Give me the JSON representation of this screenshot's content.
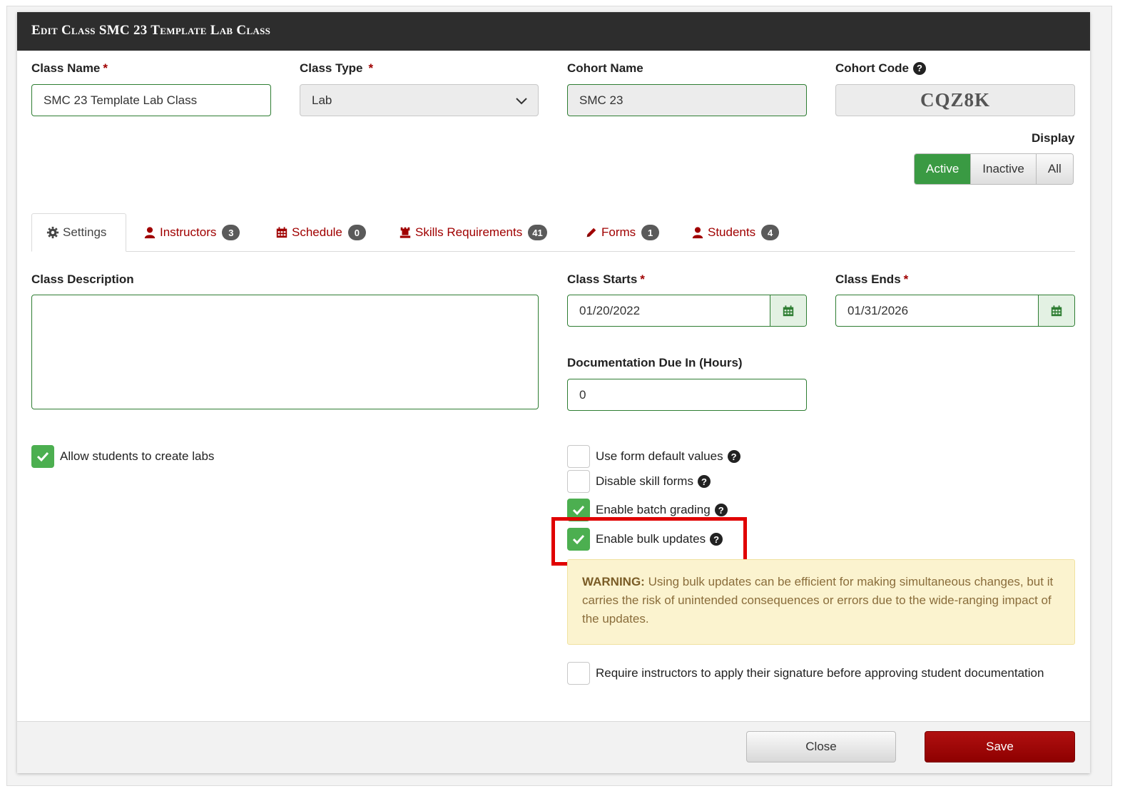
{
  "modal": {
    "title": "Edit Class SMC 23 Template Lab Class"
  },
  "fields": {
    "class_name": {
      "label": "Class Name",
      "required": "*",
      "value": "SMC 23 Template Lab Class"
    },
    "class_type": {
      "label": "Class Type",
      "required": "*",
      "value": "Lab"
    },
    "cohort_name": {
      "label": "Cohort Name",
      "value": "SMC 23"
    },
    "cohort_code": {
      "label": "Cohort Code",
      "value": "CQZ8K",
      "help_icon": "question-circle-icon"
    }
  },
  "display": {
    "label": "Display",
    "options": [
      "Active",
      "Inactive",
      "All"
    ],
    "selected": "Active"
  },
  "tabs": [
    {
      "label": "Settings",
      "icon": "gear-icon",
      "active": true
    },
    {
      "label": "Instructors",
      "icon": "user-icon",
      "count": "3"
    },
    {
      "label": "Schedule",
      "icon": "calendar-icon",
      "count": "0"
    },
    {
      "label": "Skills Requirements",
      "icon": "chess-rook-icon",
      "count": "41"
    },
    {
      "label": "Forms",
      "icon": "pencil-icon",
      "count": "1"
    },
    {
      "label": "Students",
      "icon": "user-icon",
      "count": "4"
    }
  ],
  "settings": {
    "class_description": {
      "label": "Class Description",
      "value": ""
    },
    "class_starts": {
      "label": "Class Starts",
      "required": "*",
      "value": "01/20/2022"
    },
    "class_ends": {
      "label": "Class Ends",
      "required": "*",
      "value": "01/31/2026"
    },
    "documentation_due": {
      "label": "Documentation Due In (Hours)",
      "value": "0"
    },
    "allow_students_create_labs": {
      "label": "Allow students to create labs",
      "checked": true
    },
    "use_form_defaults": {
      "label": "Use form default values",
      "checked": false
    },
    "disable_skill_forms": {
      "label": "Disable skill forms",
      "checked": false
    },
    "enable_batch_grading": {
      "label": "Enable batch grading",
      "checked": true
    },
    "enable_bulk_updates": {
      "label": "Enable bulk updates",
      "checked": true
    },
    "require_signature": {
      "label": "Require instructors to apply their signature before approving student documentation",
      "checked": false
    }
  },
  "warning": {
    "prefix": "WARNING:",
    "text": "Using bulk updates can be efficient for making simultaneous changes, but it carries the risk of unintended consequences or errors due to the wide-ranging impact of the updates."
  },
  "footer": {
    "close_label": "Close",
    "save_label": "Save"
  },
  "colors": {
    "header_bg": "#2d2d2d",
    "accent_red": "#a00000",
    "accent_green": "#4caf50",
    "warning_bg": "#fbf3cf",
    "highlight_red": "#e00000"
  }
}
